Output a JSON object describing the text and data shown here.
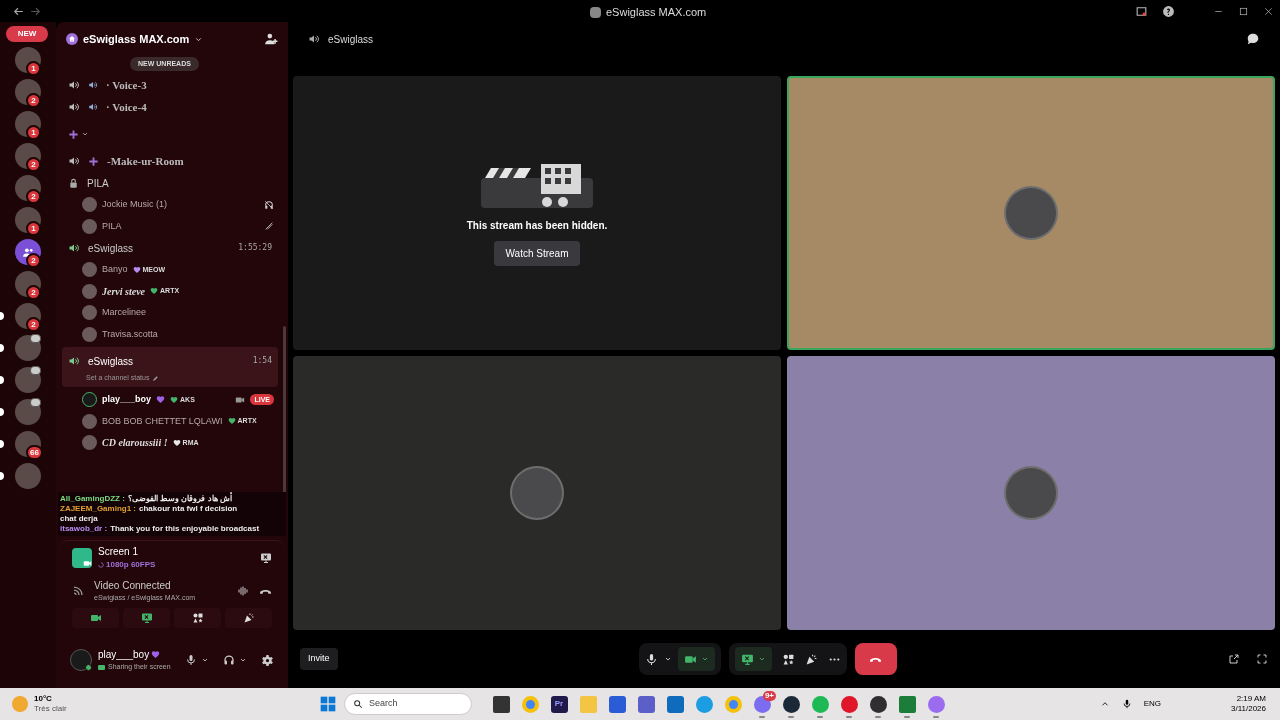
{
  "window": {
    "title": "eSwiglass MAX.com"
  },
  "new_pill": {
    "label": "NEW"
  },
  "servers": [
    {
      "kind": "server",
      "badge": "1",
      "unread": false,
      "live": false
    },
    {
      "kind": "server",
      "badge": "2",
      "unread": false,
      "live": false
    },
    {
      "kind": "server",
      "badge": "1",
      "unread": false,
      "live": false
    },
    {
      "kind": "server",
      "badge": "2",
      "unread": false,
      "live": false
    },
    {
      "kind": "server",
      "badge": "2",
      "unread": false,
      "live": false
    },
    {
      "kind": "server",
      "badge": "1",
      "unread": false,
      "live": false
    },
    {
      "kind": "group",
      "badge": "2",
      "unread": false,
      "live": false
    },
    {
      "kind": "server",
      "badge": "2",
      "unread": false,
      "live": false
    },
    {
      "kind": "server",
      "badge": "2",
      "unread": true,
      "live": false
    },
    {
      "kind": "server",
      "unread": true,
      "live": true
    },
    {
      "kind": "server",
      "unread": true,
      "live": true
    },
    {
      "kind": "server",
      "unread": true,
      "live": true
    },
    {
      "kind": "server",
      "badge": "66",
      "unread": true,
      "live": false
    },
    {
      "kind": "server",
      "unread": true,
      "live": false
    }
  ],
  "server_header": {
    "name": "eSwiglass MAX.com"
  },
  "new_unreads": "NEW UNREADS",
  "channels": [
    {
      "kind": "voice",
      "speaker_emoji": true,
      "fancy": true,
      "name": "· Voice-3",
      "selected": false
    },
    {
      "kind": "voice",
      "speaker_emoji": true,
      "fancy": true,
      "name": "· Voice-4",
      "selected": false
    },
    {
      "kind": "category",
      "expanded": true
    },
    {
      "kind": "voice",
      "plus_emoji": true,
      "fancy": true,
      "name": "-Make-ur-Room",
      "selected": false
    },
    {
      "kind": "locked",
      "name": "PILA",
      "selected": false,
      "members": [
        {
          "name": "Jockie Music (1)",
          "deafened": true,
          "muted": false
        },
        {
          "name": "PILA",
          "deafened": false,
          "muted": true
        }
      ]
    },
    {
      "kind": "voice",
      "name": "eSwiglass",
      "timer": "1:55:29",
      "selected": false,
      "members": [
        {
          "name": "Banyo",
          "tag": "MEOW",
          "color": "#b98cf2"
        },
        {
          "name": "Jervi steve",
          "fancy": true,
          "tag": "ARTX",
          "color": "#43b56a"
        },
        {
          "name": "Marcelinee"
        },
        {
          "name": "Travisa.scotta"
        }
      ]
    },
    {
      "kind": "voice",
      "name": "eSwiglass",
      "timer": "1:54",
      "selected": true,
      "status_hint": "Set a channel status",
      "members": [
        {
          "name": "play___boy",
          "me": true,
          "heart": true,
          "tag": "AKS",
          "color": "#43b56a",
          "camera": true,
          "live": "LIVE"
        },
        {
          "name": "BOB BOB CHETTET LQLAWI",
          "tag": "ARTX",
          "color": "#43b56a"
        },
        {
          "name": "CD elaroussiii !",
          "fancy": true,
          "tag": "RMA",
          "color": "#e6e6e6"
        }
      ]
    }
  ],
  "stream_chat": [
    {
      "user": "All_GamingDZZ :",
      "color": "#7fd97f",
      "text": "أش هاد فروقان وسط الفوضى؟"
    },
    {
      "user": "ZAJEEM_Gaming1 :",
      "color": "#e0a030",
      "text": "chakour nta fwl f decision"
    },
    {
      "text": "chat derja"
    },
    {
      "user": "itsawob_dr :",
      "color": "#b98cf2",
      "text": "Thank you for this enjoyable broadcast"
    }
  ],
  "screen_panel": {
    "title": "Screen 1",
    "quality": "1080p 60FPS"
  },
  "voice_panel": {
    "status": "Video Connected",
    "location": "eSwiglass / eSwiglass MAX.com"
  },
  "voice_actions": [
    {
      "kind": "camera",
      "on": true
    },
    {
      "kind": "screen",
      "on": true
    },
    {
      "kind": "activities",
      "on": false
    },
    {
      "kind": "soundboard",
      "on": false
    }
  ],
  "user": {
    "name": "play___boy",
    "heart": true,
    "status": "Sharing their screen"
  },
  "main": {
    "channel": "eSwiglass"
  },
  "tiles": [
    {
      "kind": "hidden_stream",
      "message": "This stream has been hidden.",
      "button": "Watch Stream"
    },
    {
      "kind": "avatar",
      "color": "#a68a66",
      "speaking": true
    },
    {
      "kind": "avatar",
      "color": "#2a2a28",
      "speaking": false
    },
    {
      "kind": "avatar",
      "color": "#8a80a8",
      "speaking": false
    }
  ],
  "controls": {
    "invite": "Invite",
    "camera_on": true,
    "screen_on": true
  },
  "taskbar": {
    "weather": {
      "temp": "10°C",
      "condition": "Très clair"
    },
    "search": {
      "placeholder": "Search"
    },
    "apps": [
      {
        "kind": "taskview",
        "running": false
      },
      {
        "kind": "chrome",
        "running": false
      },
      {
        "kind": "premiere",
        "label": "Pr",
        "running": false
      },
      {
        "kind": "folder",
        "running": false
      },
      {
        "kind": "store",
        "running": false
      },
      {
        "kind": "teams",
        "running": false
      },
      {
        "kind": "outlook",
        "running": false
      },
      {
        "kind": "edge",
        "running": false
      },
      {
        "kind": "chrome",
        "running": false
      },
      {
        "kind": "discord",
        "badge": "9+",
        "running": true
      },
      {
        "kind": "steam",
        "running": true
      },
      {
        "kind": "spotify",
        "running": true
      },
      {
        "kind": "opera",
        "running": true
      },
      {
        "kind": "obs",
        "running": true
      },
      {
        "kind": "green",
        "running": true
      },
      {
        "kind": "purple",
        "running": true
      }
    ],
    "language": "ENG",
    "time": "2:19 AM",
    "date": "3/11/2026"
  }
}
